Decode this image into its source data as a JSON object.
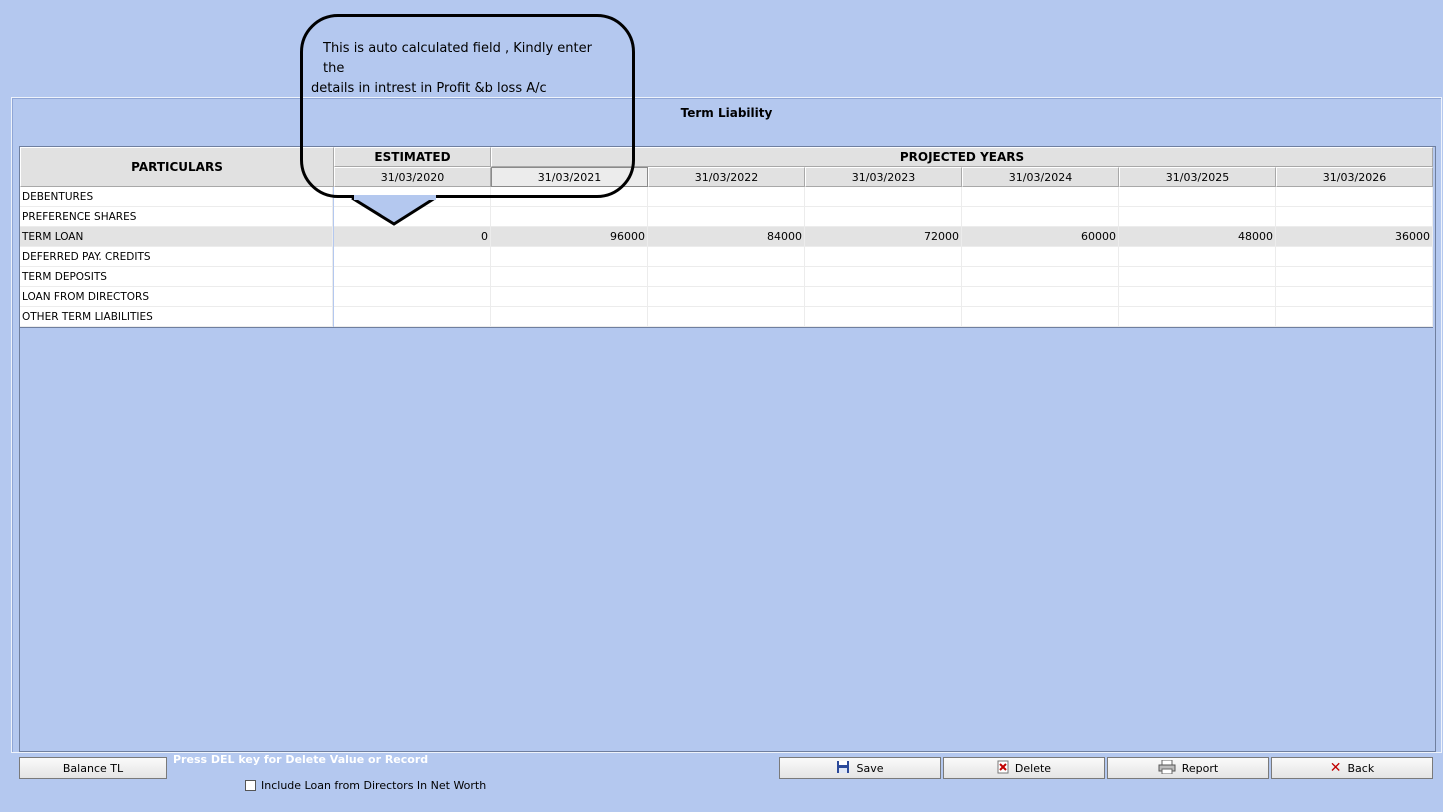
{
  "window": {
    "title": "Term Liability"
  },
  "grid": {
    "particulars_header": "PARTICULARS",
    "estimated_header": "ESTIMATED",
    "projected_header": "PROJECTED YEARS",
    "dates": [
      "31/03/2020",
      "31/03/2021",
      "31/03/2022",
      "31/03/2023",
      "31/03/2024",
      "31/03/2025",
      "31/03/2026"
    ],
    "rows": [
      {
        "label": "DEBENTURES",
        "values": [
          "",
          "",
          "",
          "",
          "",
          "",
          ""
        ]
      },
      {
        "label": "PREFERENCE SHARES",
        "values": [
          "",
          "",
          "",
          "",
          "",
          "",
          ""
        ]
      },
      {
        "label": "TERM LOAN",
        "values": [
          "0",
          "96000",
          "84000",
          "72000",
          "60000",
          "48000",
          "36000"
        ]
      },
      {
        "label": "DEFERRED PAY. CREDITS",
        "values": [
          "",
          "",
          "",
          "",
          "",
          "",
          ""
        ]
      },
      {
        "label": "TERM DEPOSITS",
        "values": [
          "",
          "",
          "",
          "",
          "",
          "",
          ""
        ]
      },
      {
        "label": "LOAN FROM DIRECTORS",
        "values": [
          "",
          "",
          "",
          "",
          "",
          "",
          ""
        ]
      },
      {
        "label": "OTHER TERM LIABILITIES",
        "values": [
          "",
          "",
          "",
          "",
          "",
          "",
          ""
        ]
      }
    ]
  },
  "callout": {
    "line1": "This is auto calculated field , Kindly enter the",
    "line2": "details in intrest in Profit &b loss A/c"
  },
  "footer": {
    "balance_label": "Balance TL",
    "hint": "Press DEL key for Delete Value or Record",
    "checkbox_label": "Include Loan from Directors In Net Worth",
    "save_label": "Save",
    "delete_label": "Delete",
    "report_label": "Report",
    "back_label": "Back"
  },
  "colors": {
    "background": "#b4c8ef",
    "selected_cell": "#c8c8ff"
  }
}
